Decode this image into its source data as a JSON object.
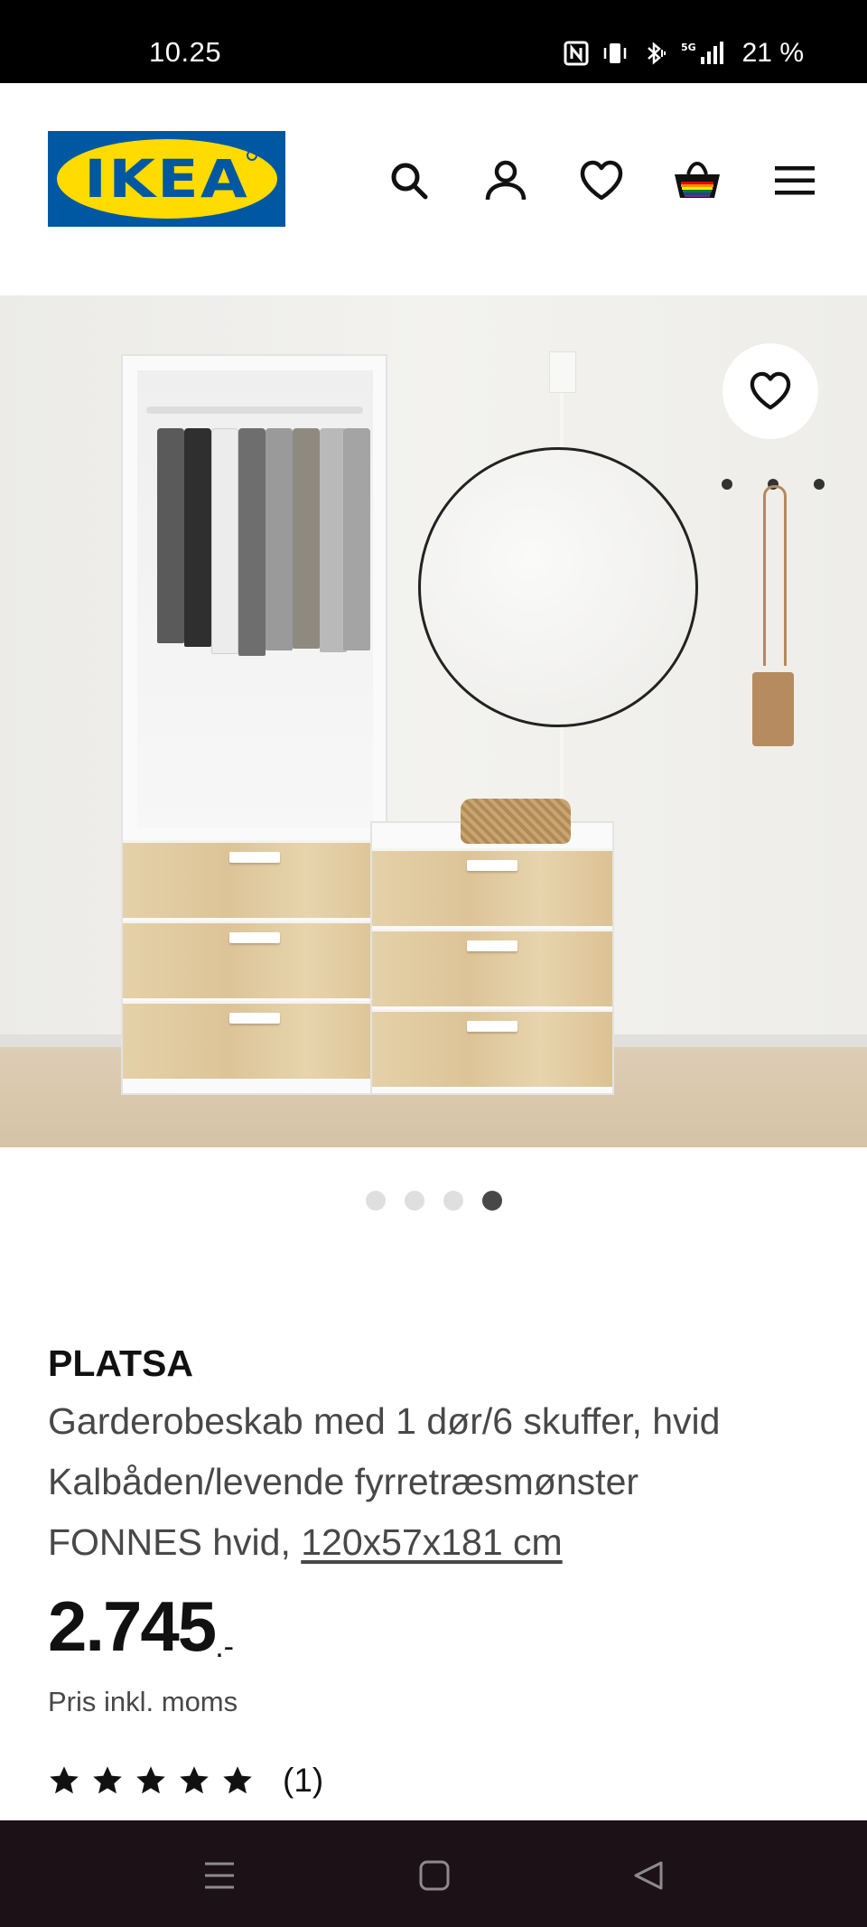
{
  "status_bar": {
    "time": "10.25",
    "battery": "21 %",
    "network": "5G"
  },
  "header": {
    "logo_text": "IKEA",
    "icons": [
      "search-icon",
      "profile-icon",
      "heart-icon",
      "basket-icon",
      "menu-icon"
    ]
  },
  "carousel": {
    "total": 4,
    "active": 4
  },
  "product": {
    "name": "PLATSA",
    "line1": "Garderobeskab med 1 dør/6 skuffer, hvid",
    "line2": "Kalbåden/levende fyrretræsmønster",
    "line3_prefix": "FONNES hvid, ",
    "dimensions": "120x57x181 cm",
    "price_int": "2.745",
    "price_dec": ".-",
    "price_note": "Pris inkl. moms",
    "rating_stars": 5,
    "rating_count": "(1)"
  },
  "colors": {
    "ikea_blue": "#0058a3",
    "ikea_yellow": "#ffdb00",
    "text_primary": "#111111",
    "text_secondary": "#484848"
  }
}
